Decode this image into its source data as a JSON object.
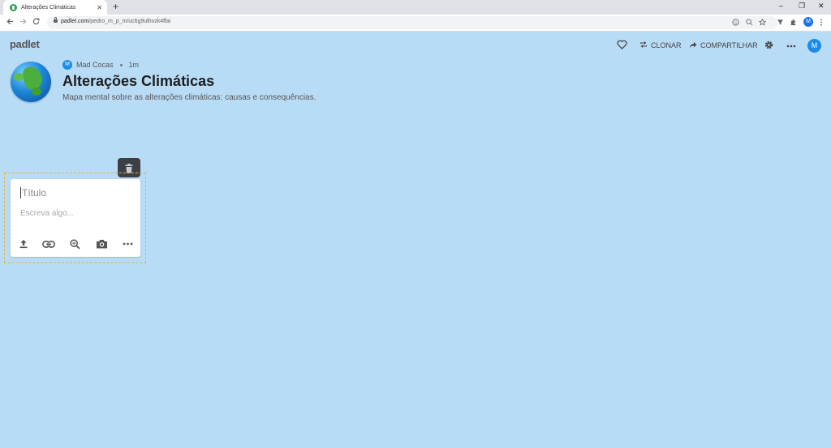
{
  "browser": {
    "tab_title": "Alterações Climáticas",
    "tab_close": "✕",
    "new_tab": "+",
    "url_host": "padlet.com",
    "url_path": "/pedro_m_p_m/uc6g9ulhvzk4ffai",
    "profile_initial": "M",
    "controls": {
      "minimize": "–",
      "restore": "❐",
      "close": "✕"
    }
  },
  "header": {
    "logo": "padlet",
    "clone_label": "CLONAR",
    "share_label": "COMPARTILHAR",
    "user_initial": "M",
    "icons": [
      "heart-icon",
      "clone-icon",
      "share-icon",
      "settings-icon",
      "more-icon"
    ]
  },
  "board": {
    "author_initial": "M",
    "author": "Mad Cocas",
    "time_ago": "1m",
    "title": "Alterações Climáticas",
    "description": "Mapa mental sobre as alterações climáticas: causas e consequências."
  },
  "composer": {
    "title_placeholder": "Título",
    "body_placeholder": "Escreva algo...",
    "tools": [
      "upload-icon",
      "link-icon",
      "search-image-icon",
      "camera-icon",
      "more-icon"
    ]
  },
  "colors": {
    "background": "#b9dcf6",
    "accent": "#1a8ce8",
    "selection_outline": "#e2b53c",
    "delete_button": "#3c3f45"
  }
}
